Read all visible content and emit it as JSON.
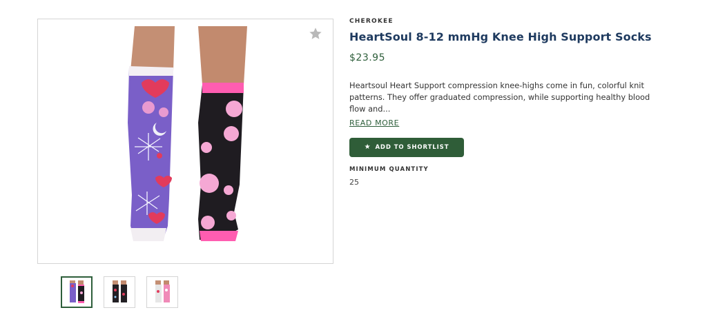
{
  "product": {
    "brand": "CHEROKEE",
    "title": "HeartSoul 8-12 mmHg Knee High Support Socks",
    "price": "$23.95",
    "description": "Heartsoul Heart Support compression knee-highs come in fun, colorful knit patterns. They offer graduated compression, while supporting healthy blood flow and...",
    "read_more_label": "READ MORE",
    "shortlist_button_label": "ADD TO SHORTLIST",
    "minimum_quantity_label": "MINIMUM QUANTITY",
    "minimum_quantity_value": "25"
  },
  "gallery": {
    "favorite_icon": "star-icon",
    "thumbnails": [
      {
        "name": "thumbnail-1",
        "active": true
      },
      {
        "name": "thumbnail-2",
        "active": false
      },
      {
        "name": "thumbnail-3",
        "active": false
      }
    ]
  },
  "colors": {
    "accent_green": "#2f5d38",
    "title_blue": "#1e3a5f",
    "price_green": "#2d5e3a"
  }
}
